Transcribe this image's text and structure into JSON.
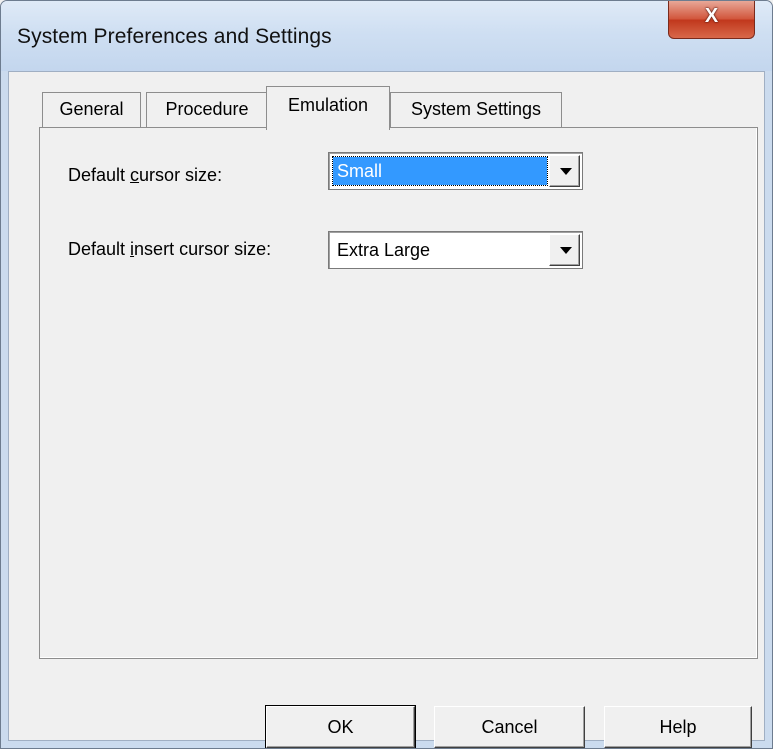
{
  "window": {
    "title": "System Preferences and Settings",
    "close_glyph": "X"
  },
  "tabs": [
    {
      "label": "General",
      "active": false
    },
    {
      "label": "Procedure",
      "active": false
    },
    {
      "label": "Emulation",
      "active": true
    },
    {
      "label": "System Settings",
      "active": false
    }
  ],
  "emulation": {
    "cursor_size": {
      "label_pre": "Default ",
      "label_mnemonic": "c",
      "label_post": "ursor size:",
      "value": "Small"
    },
    "insert_cursor_size": {
      "label_pre": "Default ",
      "label_mnemonic": "i",
      "label_post": "nsert cursor size:",
      "value": "Extra Large"
    }
  },
  "buttons": {
    "ok": "OK",
    "cancel": "Cancel",
    "help": "Help"
  },
  "colors": {
    "selection": "#3399ff",
    "close_button": "#c1381d",
    "title_bar": "#cfdff2"
  }
}
